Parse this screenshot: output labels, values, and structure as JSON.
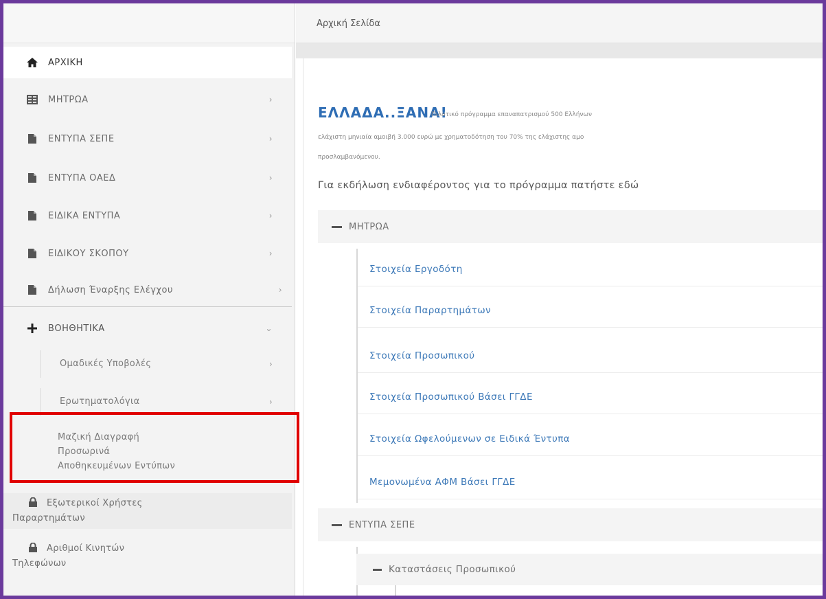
{
  "breadcrumb": "Αρχική Σελίδα",
  "sidebar": {
    "items": [
      {
        "label": "ΑΡΧΙΚΗ",
        "icon": "home-icon",
        "chevron": ""
      },
      {
        "label": "ΜΗΤΡΩΑ",
        "icon": "registry-icon",
        "chevron": "›"
      },
      {
        "label": "ΕΝΤΥΠΑ ΣΕΠΕ",
        "icon": "document-icon",
        "chevron": "›"
      },
      {
        "label": "ΕΝΤΥΠΑ ΟΑΕΔ",
        "icon": "document-icon",
        "chevron": "›"
      },
      {
        "label": "ΕΙΔΙΚΑ ΕΝΤΥΠΑ",
        "icon": "document-icon",
        "chevron": "›"
      },
      {
        "label": "ΕΙΔΙΚΟΥ ΣΚΟΠΟΥ",
        "icon": "document-icon",
        "chevron": "›"
      },
      {
        "label": "Δήλωση Έναρξης Ελέγχου",
        "icon": "document-icon",
        "chevron": "›"
      },
      {
        "label": "ΒΟΗΘΗΤΙΚΑ",
        "icon": "plus-icon",
        "chevron": "⌄"
      }
    ],
    "sub_items": [
      {
        "label": "Ομαδικές Υποβολές",
        "chevron": "›"
      },
      {
        "label": "Ερωτηματολόγια",
        "chevron": "›"
      }
    ],
    "highlighted_item": {
      "line1": "Μαζική Διαγραφή",
      "line2": "Προσωρινά",
      "line3": "Αποθηκευμένων Εντύπων"
    },
    "external": [
      {
        "line1": "Εξωτερικοί Χρήστες",
        "line2": "Παραρτημάτων",
        "icon": "lock-icon"
      },
      {
        "line1": "Αριθμοί Κινητών",
        "line2": "Τηλεφώνων",
        "icon": "lock-icon"
      }
    ]
  },
  "promo": {
    "title": "ΕΛΛΑΔΑ..ΞΑΝΑ!",
    "line1": "Πιλοτικό πρόγραμμα επαναπατρισμού 500 Ελλήνων",
    "line2": "ελάχιστη μηνιαία αμοιβή 3.000 ευρώ με χρηματοδότηση του 70% της ελάχιστης αμο",
    "line3": "προσλαμβανόμενου.",
    "interest": "Για εκδήλωση ενδιαφέροντος για το πρόγραμμα πατήστε εδώ"
  },
  "tree": {
    "section1": "ΜΗΤΡΩΑ",
    "links": [
      "Στοιχεία Εργοδότη",
      "Στοιχεία Παραρτημάτων",
      "Στοιχεία Προσωπικού",
      "Στοιχεία Προσωπικού Βάσει ΓΓΔΕ",
      "Στοιχεία Ωφελούμενων σε Ειδικά Έντυπα",
      "Μεμονωμένα ΑΦΜ Βάσει ΓΓΔΕ"
    ],
    "section2": "ΕΝΤΥΠΑ ΣΕΠΕ",
    "sub_section": "Καταστάσεις Προσωπικού"
  },
  "colors": {
    "frame": "#6b3a9c",
    "link": "#3d79b8",
    "highlight": "#e00000",
    "promo_title": "#2e6db4"
  }
}
